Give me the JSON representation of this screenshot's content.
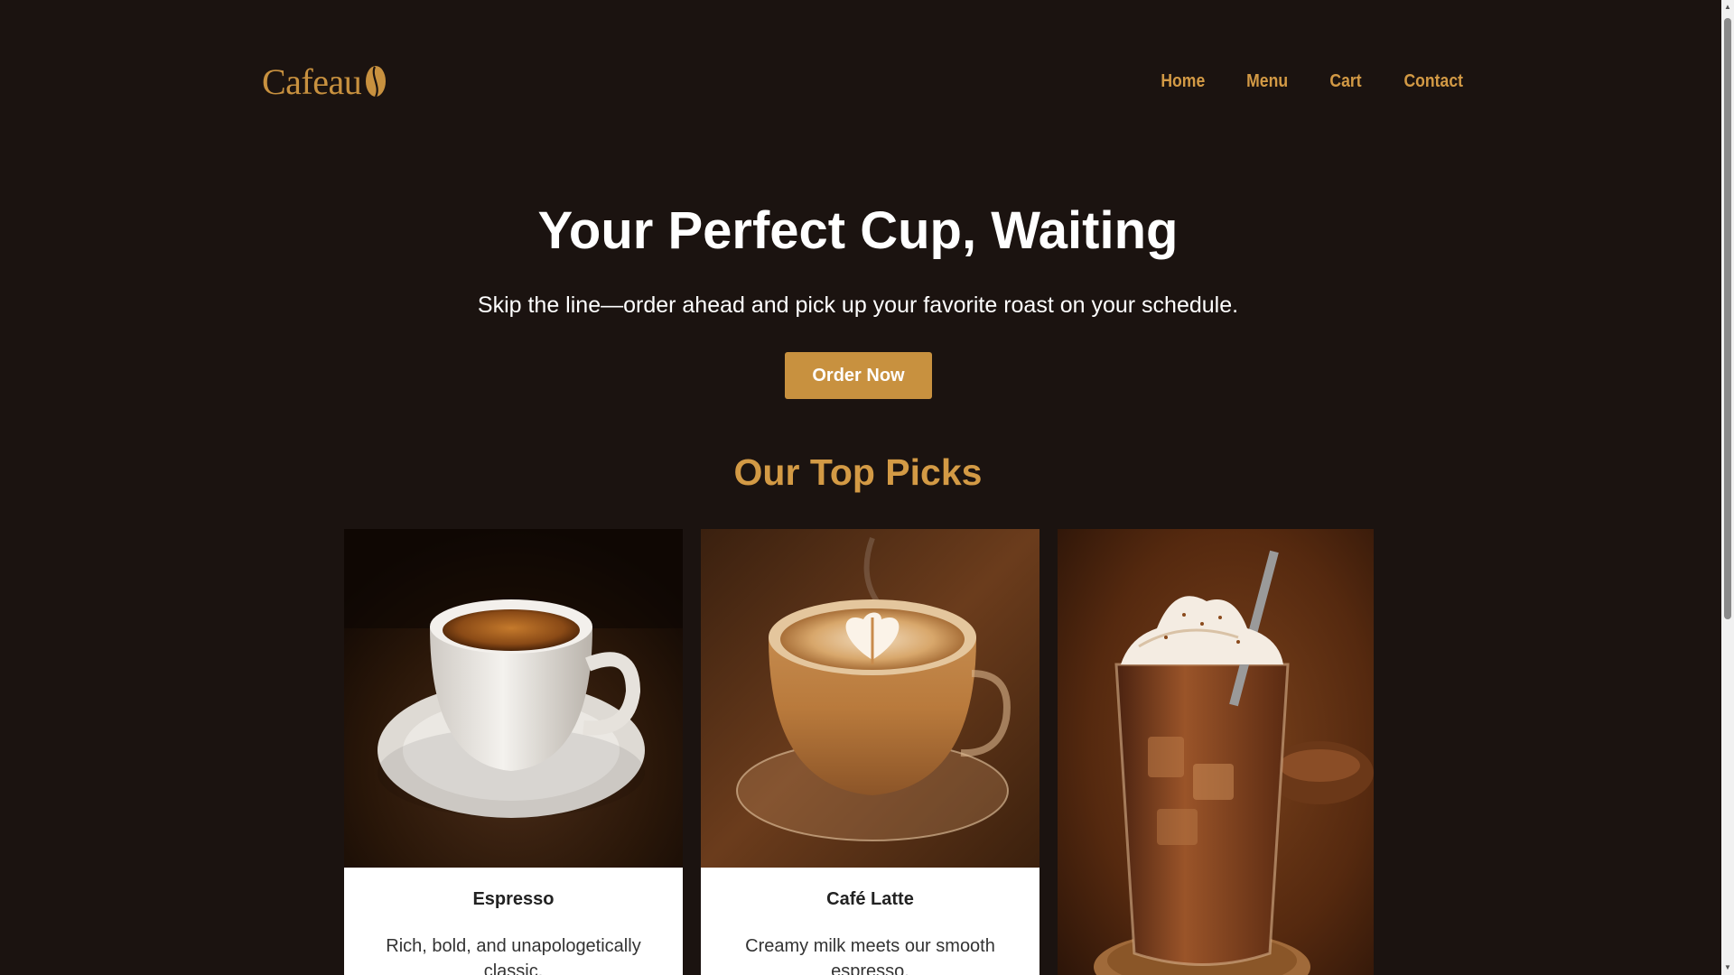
{
  "brand": {
    "name": "Cafeau",
    "accent": "#c8913f",
    "background": "#1b1310"
  },
  "nav": {
    "items": [
      "Home",
      "Menu",
      "Cart",
      "Contact"
    ]
  },
  "hero": {
    "title": "Your Perfect Cup, Waiting",
    "subtitle": "Skip the line—order ahead and pick up your favorite roast on your schedule.",
    "cta_label": "Order Now"
  },
  "top_picks": {
    "title": "Our Top Picks",
    "cards": [
      {
        "name": "Espresso",
        "description": "Rich, bold, and unapologetically classic.",
        "image": "espresso-cup-photo"
      },
      {
        "name": "Café Latte",
        "description": "Creamy milk meets our smooth espresso.",
        "image": "latte-art-cup-photo"
      },
      {
        "name": "",
        "description": "",
        "image": "iced-mocha-glass-photo"
      }
    ]
  }
}
